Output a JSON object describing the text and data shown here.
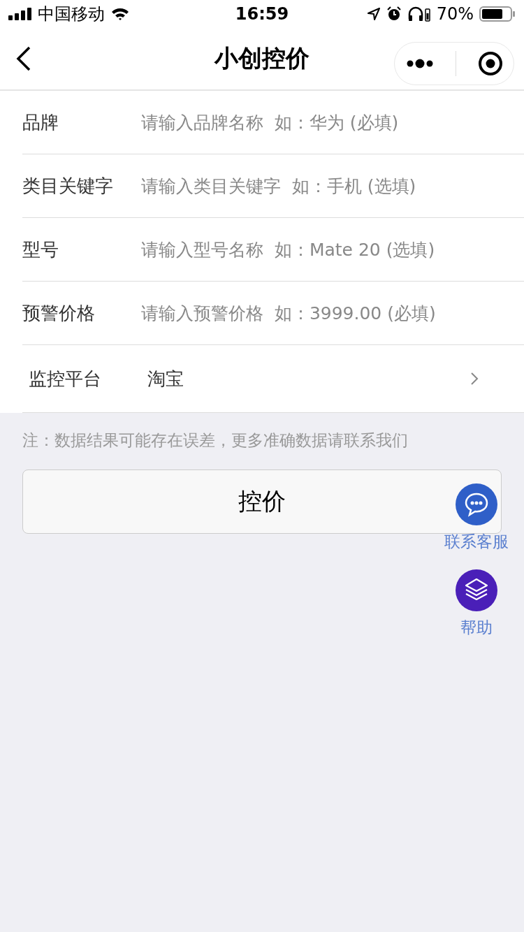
{
  "status_bar": {
    "carrier": "中国移动",
    "time": "16:59",
    "battery": "70%"
  },
  "nav": {
    "title": "小创控价"
  },
  "fields": [
    {
      "label": "品牌",
      "placeholder": "请输入品牌名称  如：华为 (必填)"
    },
    {
      "label": "类目关键字",
      "placeholder": "请输入类目关键字  如：手机 (选填)"
    },
    {
      "label": "型号",
      "placeholder": "请输入型号名称  如：Mate 20 (选填)"
    },
    {
      "label": "预警价格",
      "placeholder": "请输入预警价格  如：3999.00 (必填)"
    }
  ],
  "platform": {
    "label": "监控平台",
    "value": "淘宝"
  },
  "note": "注：数据结果可能存在误差，更多准确数据请联系我们",
  "submit": "控价",
  "floating": [
    {
      "label": "联系客服",
      "kind": "chat",
      "color": "#2f5fc8"
    },
    {
      "label": "帮助",
      "kind": "layers",
      "color": "#4a1fb8"
    }
  ]
}
